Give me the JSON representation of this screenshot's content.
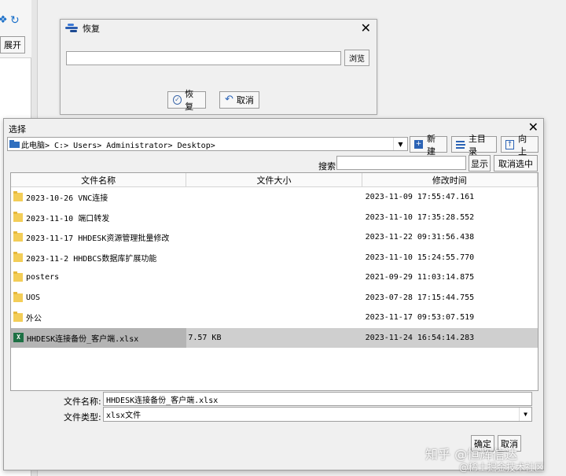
{
  "background": {
    "expand_label": "展开"
  },
  "restore_dialog": {
    "title": "恢复",
    "path_value": "",
    "browse_label": "浏览",
    "ok_label": "恢复",
    "cancel_label": "取消"
  },
  "select_dialog": {
    "title": "选择",
    "path": "此电脑> C:> Users> Administrator> Desktop>",
    "new_folder_label": "新建",
    "home_dir_label": "主目录",
    "up_label": "向上",
    "search_label": "搜索",
    "search_value": "",
    "show_label": "显示",
    "cancel_filter_label": "取消选中",
    "columns": [
      "文件名称",
      "文件大小",
      "修改时间"
    ],
    "rows": [
      {
        "type": "folder",
        "name": "2023-10-26 VNC连接",
        "size": "",
        "modified": "2023-11-09 17:55:47.161"
      },
      {
        "type": "folder",
        "name": "2023-11-10 端口转发",
        "size": "",
        "modified": "2023-11-10 17:35:28.552"
      },
      {
        "type": "folder",
        "name": "2023-11-17 HHDESK资源管理批量修改",
        "size": "",
        "modified": "2023-11-22 09:31:56.438"
      },
      {
        "type": "folder",
        "name": "2023-11-2 HHDBCS数据库扩展功能",
        "size": "",
        "modified": "2023-11-10 15:24:55.770"
      },
      {
        "type": "folder",
        "name": "posters",
        "size": "",
        "modified": "2021-09-29 11:03:14.875"
      },
      {
        "type": "folder",
        "name": "UOS",
        "size": "",
        "modified": "2023-07-28 17:15:44.755"
      },
      {
        "type": "folder",
        "name": "外公",
        "size": "",
        "modified": "2023-11-17 09:53:07.519"
      },
      {
        "type": "xlsx",
        "name": "HHDESK连接备份_客户端.xlsx",
        "size": "7.57 KB",
        "modified": "2023-11-24 16:54:14.283",
        "selected": true
      }
    ],
    "filename_label": "文件名称:",
    "filename_value": "HHDESK连接备份_客户端.xlsx",
    "filetype_label": "文件类型:",
    "filetype_value": "xlsx文件",
    "confirm_label": "确定",
    "cancel_label": "取消"
  },
  "watermark": {
    "line1": "知乎 @恒辉信达",
    "line2": "@稀土掘金技术社区"
  }
}
